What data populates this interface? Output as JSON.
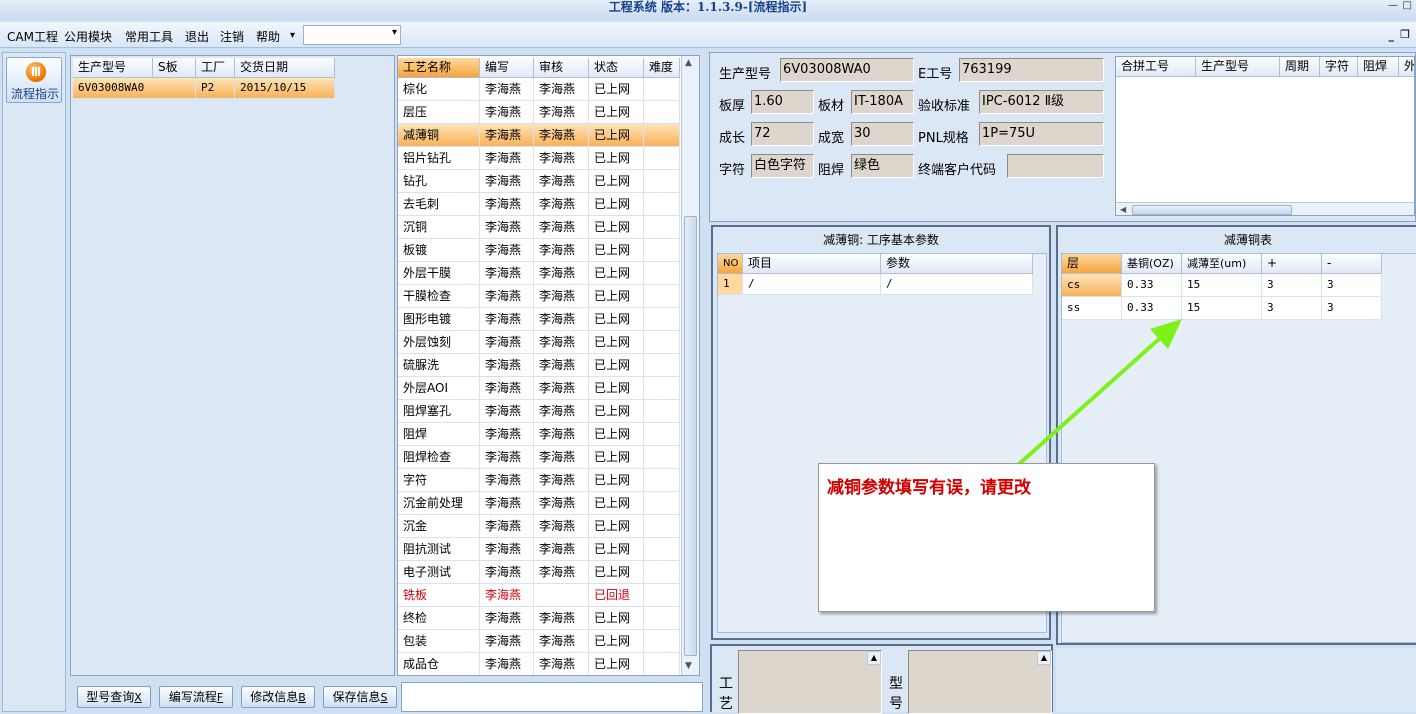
{
  "window": {
    "title": "工程系统 版本：1.1.3.9-[流程指示]",
    "min_glyph": "—",
    "close_glyph": "□"
  },
  "menu": {
    "items": [
      "CAM工程",
      "公用模块",
      "常用工具",
      "退出",
      "注销",
      "帮助"
    ],
    "help_arrow": "▾",
    "dropdown_value": "",
    "mdi_min": "_",
    "mdi_restore": "❐"
  },
  "leftbar": {
    "flow_button_label": "流程指示"
  },
  "model_list": {
    "columns": [
      "生产型号",
      "S板",
      "工厂",
      "交货日期"
    ],
    "rows": [
      {
        "model": "6V03008WA0",
        "s": "",
        "factory": "P2",
        "date": "2015/10/15"
      }
    ]
  },
  "process_list": {
    "columns": [
      "工艺名称",
      "编写",
      "审核",
      "状态",
      "难度"
    ],
    "rows": [
      {
        "name": "棕化",
        "writer": "李海燕",
        "reviewer": "李海燕",
        "status": "已上网"
      },
      {
        "name": "层压",
        "writer": "李海燕",
        "reviewer": "李海燕",
        "status": "已上网"
      },
      {
        "name": "减薄铜",
        "writer": "李海燕",
        "reviewer": "李海燕",
        "status": "已上网"
      },
      {
        "name": "铝片钻孔",
        "writer": "李海燕",
        "reviewer": "李海燕",
        "status": "已上网"
      },
      {
        "name": "钻孔",
        "writer": "李海燕",
        "reviewer": "李海燕",
        "status": "已上网"
      },
      {
        "name": "去毛刺",
        "writer": "李海燕",
        "reviewer": "李海燕",
        "status": "已上网"
      },
      {
        "name": "沉铜",
        "writer": "李海燕",
        "reviewer": "李海燕",
        "status": "已上网"
      },
      {
        "name": "板镀",
        "writer": "李海燕",
        "reviewer": "李海燕",
        "status": "已上网"
      },
      {
        "name": "外层干膜",
        "writer": "李海燕",
        "reviewer": "李海燕",
        "status": "已上网"
      },
      {
        "name": "干膜检查",
        "writer": "李海燕",
        "reviewer": "李海燕",
        "status": "已上网"
      },
      {
        "name": "图形电镀",
        "writer": "李海燕",
        "reviewer": "李海燕",
        "status": "已上网"
      },
      {
        "name": "外层蚀刻",
        "writer": "李海燕",
        "reviewer": "李海燕",
        "status": "已上网"
      },
      {
        "name": "硫脲洗",
        "writer": "李海燕",
        "reviewer": "李海燕",
        "status": "已上网"
      },
      {
        "name": "外层AOI",
        "writer": "李海燕",
        "reviewer": "李海燕",
        "status": "已上网"
      },
      {
        "name": "阻焊塞孔",
        "writer": "李海燕",
        "reviewer": "李海燕",
        "status": "已上网"
      },
      {
        "name": "阻焊",
        "writer": "李海燕",
        "reviewer": "李海燕",
        "status": "已上网"
      },
      {
        "name": "阻焊检查",
        "writer": "李海燕",
        "reviewer": "李海燕",
        "status": "已上网"
      },
      {
        "name": "字符",
        "writer": "李海燕",
        "reviewer": "李海燕",
        "status": "已上网"
      },
      {
        "name": "沉金前处理",
        "writer": "李海燕",
        "reviewer": "李海燕",
        "status": "已上网"
      },
      {
        "name": "沉金",
        "writer": "李海燕",
        "reviewer": "李海燕",
        "status": "已上网"
      },
      {
        "name": "阻抗测试",
        "writer": "李海燕",
        "reviewer": "李海燕",
        "status": "已上网"
      },
      {
        "name": "电子测试",
        "writer": "李海燕",
        "reviewer": "李海燕",
        "status": "已上网"
      },
      {
        "name": "铣板",
        "writer": "李海燕",
        "reviewer": "",
        "status": "已回退"
      },
      {
        "name": "终检",
        "writer": "李海燕",
        "reviewer": "李海燕",
        "status": "已上网"
      },
      {
        "name": "包装",
        "writer": "李海燕",
        "reviewer": "李海燕",
        "status": "已上网"
      },
      {
        "name": "成品仓",
        "writer": "李海燕",
        "reviewer": "李海燕",
        "status": "已上网"
      }
    ]
  },
  "info": {
    "model_label": "生产型号",
    "model": "6V03008WA0",
    "e_label": "E工号",
    "e_no": "763199",
    "thick_label": "板厚",
    "thick": "1.60",
    "material_label": "板材",
    "material": "IT-180A",
    "std_label": "验收标准",
    "std": "IPC-6012 Ⅱ级",
    "len_label": "成长",
    "len": "72",
    "wid_label": "成宽",
    "wid": "30",
    "pnl_label": "PNL规格",
    "pnl": "1P=75U",
    "char_label": "字符",
    "char": "白色字符",
    "mask_label": "阻焊",
    "mask": "绿色",
    "cust_label": "终端客户代码",
    "cust": ""
  },
  "combine_table": {
    "columns": [
      "合拼工号",
      "生产型号",
      "周期",
      "字符",
      "阻焊",
      "外层"
    ]
  },
  "params": {
    "title": "减薄铜: 工序基本参数",
    "columns": [
      "NO",
      "项目",
      "参数"
    ],
    "rows": [
      {
        "no": "1",
        "item": "/",
        "param": "/"
      }
    ]
  },
  "copper_table": {
    "title": "减薄铜表",
    "columns": [
      "层",
      "基铜(OZ)",
      "减薄至(um)",
      "+",
      "-"
    ],
    "rows": [
      {
        "layer": "cs",
        "base": "0.33",
        "to": "15",
        "plus": "3",
        "minus": "3"
      },
      {
        "layer": "ss",
        "base": "0.33",
        "to": "15",
        "plus": "3",
        "minus": "3"
      }
    ]
  },
  "buttons": {
    "query": "型号查询",
    "query_key": "X",
    "write": "编写流程",
    "write_key": "F",
    "modify": "修改信息",
    "modify_key": "B",
    "save": "保存信息",
    "save_key": "S"
  },
  "bottom": {
    "craft_label": "工艺",
    "model_label": "型号"
  },
  "popup": {
    "text": "减铜参数填写有误，请更改"
  },
  "colors": {
    "annotation_arrow": "#7ef01a",
    "error_text": "#d40000",
    "selection": "#f7b25a"
  }
}
